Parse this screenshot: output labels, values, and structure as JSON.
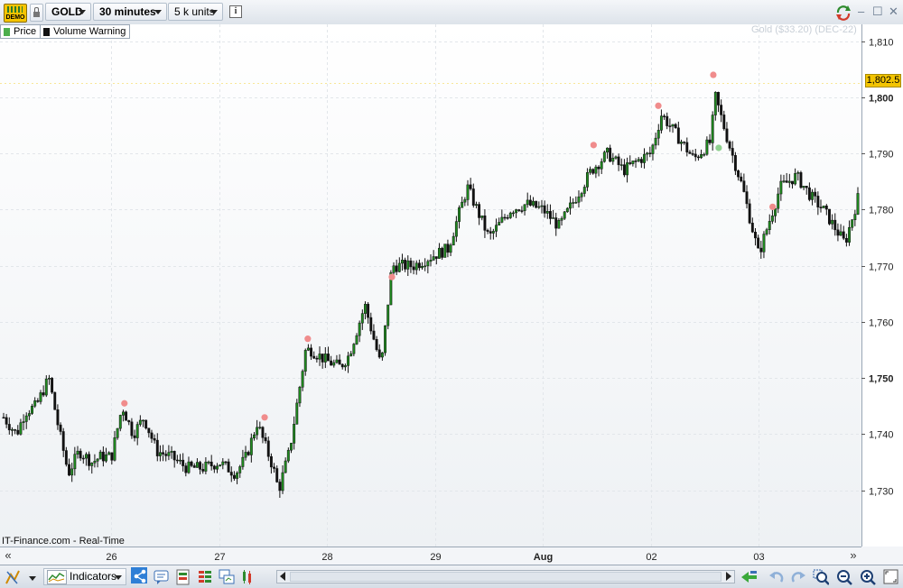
{
  "toolbar": {
    "badge": "DEMO",
    "instrument": "GOLD",
    "timeframe": "30 minutes",
    "units": "5 k units",
    "info_icon": "i"
  },
  "window_controls": {
    "minimize": "–",
    "maximize": "☐",
    "close": "✕"
  },
  "legend": [
    {
      "label": "Price",
      "color": "#4cae4c"
    },
    {
      "label": "Volume Warning",
      "color": "#111111"
    }
  ],
  "watermark": "Gold ($33.20) (DEC-22)",
  "source": "IT-Finance.com - Real-Time",
  "current_price": "1,802.5",
  "nav": {
    "left": "«",
    "right": "»"
  },
  "bottom_toolbar": {
    "indicators_label": "Indicators"
  },
  "chart_data": {
    "type": "candlestick",
    "interval": "30 minutes",
    "ylim": [
      1720,
      1813
    ],
    "y_ticks": [
      {
        "value": 1730,
        "label": "1,730",
        "bold": false
      },
      {
        "value": 1740,
        "label": "1,740",
        "bold": false
      },
      {
        "value": 1750,
        "label": "1,750",
        "bold": true
      },
      {
        "value": 1760,
        "label": "1,760",
        "bold": false
      },
      {
        "value": 1770,
        "label": "1,770",
        "bold": false
      },
      {
        "value": 1780,
        "label": "1,780",
        "bold": false
      },
      {
        "value": 1790,
        "label": "1,790",
        "bold": false
      },
      {
        "value": 1800,
        "label": "1,800",
        "bold": true
      },
      {
        "value": 1810,
        "label": "1,810",
        "bold": false
      }
    ],
    "x_ticks": [
      "26",
      "27",
      "28",
      "29",
      "Aug",
      "02",
      "03"
    ],
    "bold_x_ticks": [
      "Aug"
    ],
    "x_range_days": [
      25.0,
      32.92
    ],
    "price_path": [
      [
        25.0,
        1743
      ],
      [
        25.12,
        1740
      ],
      [
        25.2,
        1744
      ],
      [
        25.3,
        1745
      ],
      [
        25.42,
        1750
      ],
      [
        25.5,
        1742
      ],
      [
        25.6,
        1733
      ],
      [
        25.7,
        1737
      ],
      [
        25.82,
        1735
      ],
      [
        25.9,
        1736
      ],
      [
        26.0,
        1736
      ],
      [
        26.1,
        1745
      ],
      [
        26.2,
        1740
      ],
      [
        26.3,
        1743
      ],
      [
        26.42,
        1737
      ],
      [
        26.55,
        1736
      ],
      [
        26.7,
        1734
      ],
      [
        26.85,
        1734
      ],
      [
        27.0,
        1735
      ],
      [
        27.15,
        1733
      ],
      [
        27.25,
        1736
      ],
      [
        27.35,
        1742
      ],
      [
        27.5,
        1734
      ],
      [
        27.55,
        1730
      ],
      [
        27.65,
        1737
      ],
      [
        27.8,
        1755
      ],
      [
        27.85,
        1755
      ],
      [
        28.0,
        1753
      ],
      [
        28.12,
        1752
      ],
      [
        28.2,
        1754
      ],
      [
        28.35,
        1763
      ],
      [
        28.5,
        1752
      ],
      [
        28.6,
        1770
      ],
      [
        28.8,
        1770
      ],
      [
        29.0,
        1772
      ],
      [
        29.12,
        1773
      ],
      [
        29.3,
        1784
      ],
      [
        29.5,
        1775
      ],
      [
        29.7,
        1780
      ],
      [
        29.85,
        1781
      ],
      [
        30.0,
        1780
      ],
      [
        30.15,
        1777
      ],
      [
        30.3,
        1782
      ],
      [
        30.45,
        1787
      ],
      [
        30.6,
        1790
      ],
      [
        30.75,
        1787
      ],
      [
        30.9,
        1789
      ],
      [
        31.0,
        1790
      ],
      [
        31.1,
        1797
      ],
      [
        31.25,
        1793
      ],
      [
        31.4,
        1789
      ],
      [
        31.55,
        1792
      ],
      [
        31.6,
        1800
      ],
      [
        31.72,
        1792
      ],
      [
        31.85,
        1784
      ],
      [
        32.0,
        1772
      ],
      [
        32.1,
        1778
      ],
      [
        32.2,
        1784
      ],
      [
        32.35,
        1786
      ],
      [
        32.5,
        1782
      ],
      [
        32.6,
        1780
      ],
      [
        32.7,
        1777
      ],
      [
        32.8,
        1774
      ],
      [
        32.92,
        1782
      ]
    ],
    "volume_warnings": [
      {
        "x": 26.12,
        "y": 1745.5,
        "color": "#f08c8c"
      },
      {
        "x": 27.42,
        "y": 1743.0,
        "color": "#f08c8c"
      },
      {
        "x": 27.82,
        "y": 1757.0,
        "color": "#f08c8c"
      },
      {
        "x": 28.6,
        "y": 1768.0,
        "color": "#f08c8c"
      },
      {
        "x": 30.47,
        "y": 1791.5,
        "color": "#f08c8c"
      },
      {
        "x": 31.07,
        "y": 1798.5,
        "color": "#f08c8c"
      },
      {
        "x": 31.58,
        "y": 1804.0,
        "color": "#f08c8c"
      },
      {
        "x": 31.63,
        "y": 1791.0,
        "color": "#8fd08f"
      },
      {
        "x": 32.13,
        "y": 1780.5,
        "color": "#f08c8c"
      }
    ],
    "colors": {
      "up": "#1f8a1f",
      "down": "#111111",
      "grid": "#e2e6ea",
      "line": "#1f8a1f"
    }
  }
}
